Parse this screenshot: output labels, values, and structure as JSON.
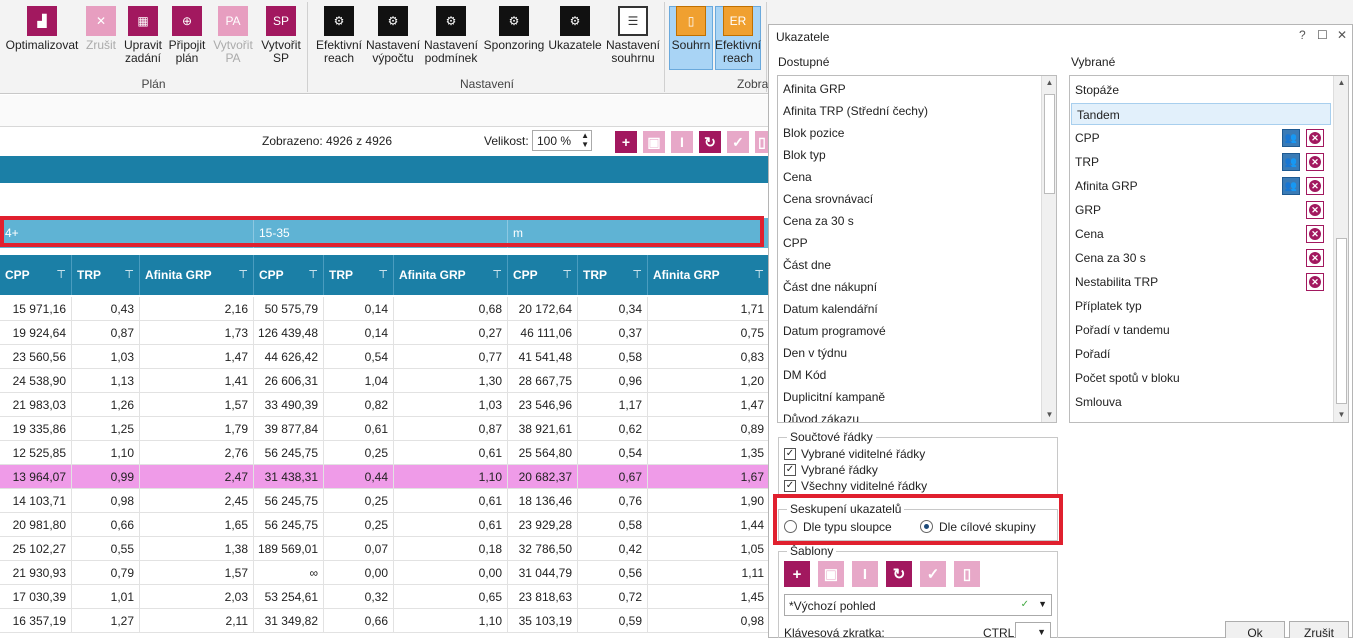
{
  "ribbon": {
    "buttons": [
      {
        "label": "Optimalizovat",
        "icon": "chart-bars-icon"
      },
      {
        "label": "Zrušit",
        "icon": "cancel-circle-icon",
        "disabled": true
      },
      {
        "label": "Upravit\nzadání",
        "icon": "grid-edit-icon"
      },
      {
        "label": "Připojit\nplán",
        "icon": "plan-attach-icon"
      },
      {
        "label": "Vytvořit\nPA",
        "icon": "pa-icon",
        "icon_text": "PA",
        "disabled": true
      },
      {
        "label": "Vytvořit\nSP",
        "icon": "sp-icon",
        "icon_text": "SP"
      },
      {
        "label": "Efektivní\nreach",
        "icon": "gear-icon"
      },
      {
        "label": "Nastavení\nvýpočtu",
        "icon": "gear-icon"
      },
      {
        "label": "Nastavení\npodmínek",
        "icon": "gear-icon"
      },
      {
        "label": "Sponzoring",
        "icon": "gear-icon"
      },
      {
        "label": "Ukazatele",
        "icon": "gear-icon"
      },
      {
        "label": "Nastavení\nsouhrnu",
        "icon": "summary-icon"
      },
      {
        "label": "Souhrn",
        "icon": "clipboard-icon"
      },
      {
        "label": "Efektivní\nreach",
        "icon": "er-icon",
        "icon_text": "ER"
      }
    ],
    "groups": {
      "plan": "Plán",
      "settings": "Nastavení",
      "display": "Zobra"
    }
  },
  "toolbar": {
    "shown": "Zobrazeno: 4926 z 4926",
    "size_label": "Velikost:",
    "size_value": "100 %"
  },
  "grid": {
    "groups": [
      "4+",
      "15-35",
      "m"
    ],
    "headers": [
      "CPP",
      "TRP",
      "Afinita GRP",
      "CPP",
      "TRP",
      "Afinita GRP",
      "CPP",
      "TRP",
      "Afinita GRP"
    ],
    "rows": [
      [
        "15 971,16",
        "0,43",
        "2,16",
        "50 575,79",
        "0,14",
        "0,68",
        "20 172,64",
        "0,34",
        "1,71"
      ],
      [
        "19 924,64",
        "0,87",
        "1,73",
        "126 439,48",
        "0,14",
        "0,27",
        "46 111,06",
        "0,37",
        "0,75"
      ],
      [
        "23 560,56",
        "1,03",
        "1,47",
        "44 626,42",
        "0,54",
        "0,77",
        "41 541,48",
        "0,58",
        "0,83"
      ],
      [
        "24 538,90",
        "1,13",
        "1,41",
        "26 606,31",
        "1,04",
        "1,30",
        "28 667,75",
        "0,96",
        "1,20"
      ],
      [
        "21 983,03",
        "1,26",
        "1,57",
        "33 490,39",
        "0,82",
        "1,03",
        "23 546,96",
        "1,17",
        "1,47"
      ],
      [
        "19 335,86",
        "1,25",
        "1,79",
        "39 877,84",
        "0,61",
        "0,87",
        "38 921,61",
        "0,62",
        "0,89"
      ],
      [
        "12 525,85",
        "1,10",
        "2,76",
        "56 245,75",
        "0,25",
        "0,61",
        "25 564,80",
        "0,54",
        "1,35"
      ],
      [
        "13 964,07",
        "0,99",
        "2,47",
        "31 438,31",
        "0,44",
        "1,10",
        "20 682,37",
        "0,67",
        "1,67"
      ],
      [
        "14 103,71",
        "0,98",
        "2,45",
        "56 245,75",
        "0,25",
        "0,61",
        "18 136,46",
        "0,76",
        "1,90"
      ],
      [
        "20 981,80",
        "0,66",
        "1,65",
        "56 245,75",
        "0,25",
        "0,61",
        "23 929,28",
        "0,58",
        "1,44"
      ],
      [
        "25 102,27",
        "0,55",
        "1,38",
        "189 569,01",
        "0,07",
        "0,18",
        "32 786,50",
        "0,42",
        "1,05"
      ],
      [
        "21 930,93",
        "0,79",
        "1,57",
        "∞",
        "0,00",
        "0,00",
        "31 044,79",
        "0,56",
        "1,11"
      ],
      [
        "17 030,39",
        "1,01",
        "2,03",
        "53 254,61",
        "0,32",
        "0,65",
        "23 818,63",
        "0,72",
        "1,45"
      ],
      [
        "16 357,19",
        "1,27",
        "2,11",
        "31 349,82",
        "0,66",
        "1,10",
        "35 103,19",
        "0,59",
        "0,98"
      ]
    ],
    "selected_row": 7
  },
  "dialog": {
    "title": "Ukazatele",
    "help": "?",
    "available_label": "Dostupné",
    "selected_label": "Vybrané",
    "available": [
      "Afinita GRP",
      "Afinita TRP (Střední čechy)",
      "Blok pozice",
      "Blok typ",
      "Cena",
      "Cena srovnávací",
      "Cena za 30 s",
      "CPP",
      "Část dne",
      "Část dne nákupní",
      "Datum kalendářní",
      "Datum programové",
      "Den v týdnu",
      "DM Kód",
      "Duplicitní kampaně",
      "Důvod zákazu"
    ],
    "selected": [
      {
        "label": "Stopáže",
        "group": false,
        "remove": false
      },
      {
        "label": "Tandem",
        "group": false,
        "remove": false
      },
      {
        "label": "CPP",
        "group": true,
        "remove": true
      },
      {
        "label": "TRP",
        "group": true,
        "remove": true
      },
      {
        "label": "Afinita GRP",
        "group": true,
        "remove": true
      },
      {
        "label": "GRP",
        "group": false,
        "remove": true
      },
      {
        "label": "Cena",
        "group": false,
        "remove": true
      },
      {
        "label": "Cena za 30 s",
        "group": false,
        "remove": true
      },
      {
        "label": "Nestabilita TRP",
        "group": false,
        "remove": true
      },
      {
        "label": "Příplatek typ",
        "group": false,
        "remove": false
      },
      {
        "label": "Pořadí v tandemu",
        "group": false,
        "remove": false
      },
      {
        "label": "Pořadí",
        "group": false,
        "remove": false
      },
      {
        "label": "Počet spotů v bloku",
        "group": false,
        "remove": false
      },
      {
        "label": "Smlouva",
        "group": false,
        "remove": false
      }
    ],
    "summary_rows": {
      "legend": "Součtové řádky",
      "options": [
        "Vybrané viditelné řádky",
        "Vybrané řádky",
        "Všechny viditelné řádky"
      ]
    },
    "grouping": {
      "legend": "Seskupení ukazatelů",
      "options": [
        "Dle typu sloupce",
        "Dle cílové skupiny"
      ],
      "selected": 1
    },
    "templates": {
      "legend": "Šablony",
      "current": "*Výchozí pohled",
      "shortcut_label": "Klávesová zkratka:",
      "shortcut_value": "CTRL+"
    },
    "ok": "Ok",
    "cancel": "Zrušit"
  },
  "colors": {
    "accent": "#a2185f",
    "header": "#1b7fa6",
    "group_header": "#5fb3d4",
    "selected_row": "#ef9be8",
    "highlight": "#e0202e"
  }
}
